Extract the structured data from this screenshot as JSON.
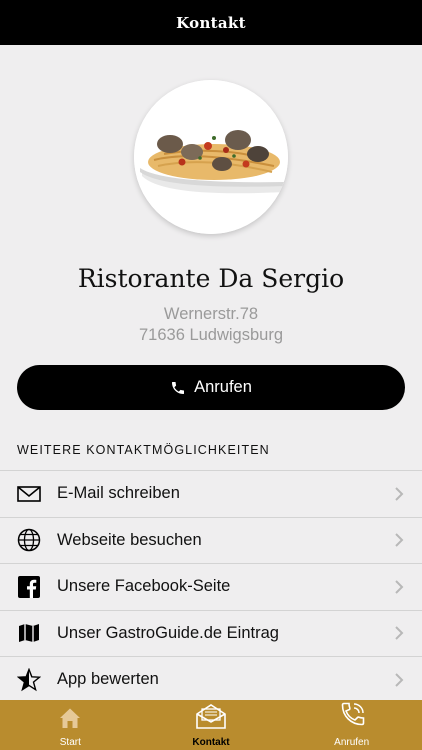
{
  "header": {
    "title": "Kontakt"
  },
  "restaurant": {
    "name": "Ristorante Da Sergio",
    "street": "Wernerstr.78",
    "city": "71636 Ludwigsburg"
  },
  "call_button": {
    "label": "Anrufen",
    "icon": "phone-icon"
  },
  "section": {
    "title": "WEITERE KONTAKTMÖGLICHKEITEN"
  },
  "contact_options": [
    {
      "label": "E-Mail schreiben",
      "icon": "envelope-icon"
    },
    {
      "label": "Webseite besuchen",
      "icon": "globe-icon"
    },
    {
      "label": "Unsere Facebook-Seite",
      "icon": "facebook-icon"
    },
    {
      "label": "Unser GastroGuide.de Eintrag",
      "icon": "map-icon"
    },
    {
      "label": "App bewerten",
      "icon": "star-icon"
    }
  ],
  "tabbar": {
    "tabs": [
      {
        "label": "Start",
        "icon": "home-icon"
      },
      {
        "label": "Kontakt",
        "icon": "mail-icon"
      },
      {
        "label": "Anrufen",
        "icon": "phone-icon"
      }
    ],
    "active_tab": "Kontakt"
  },
  "colors": {
    "accent": "#b98c2e",
    "header": "#000000",
    "background": "#efeeef"
  }
}
